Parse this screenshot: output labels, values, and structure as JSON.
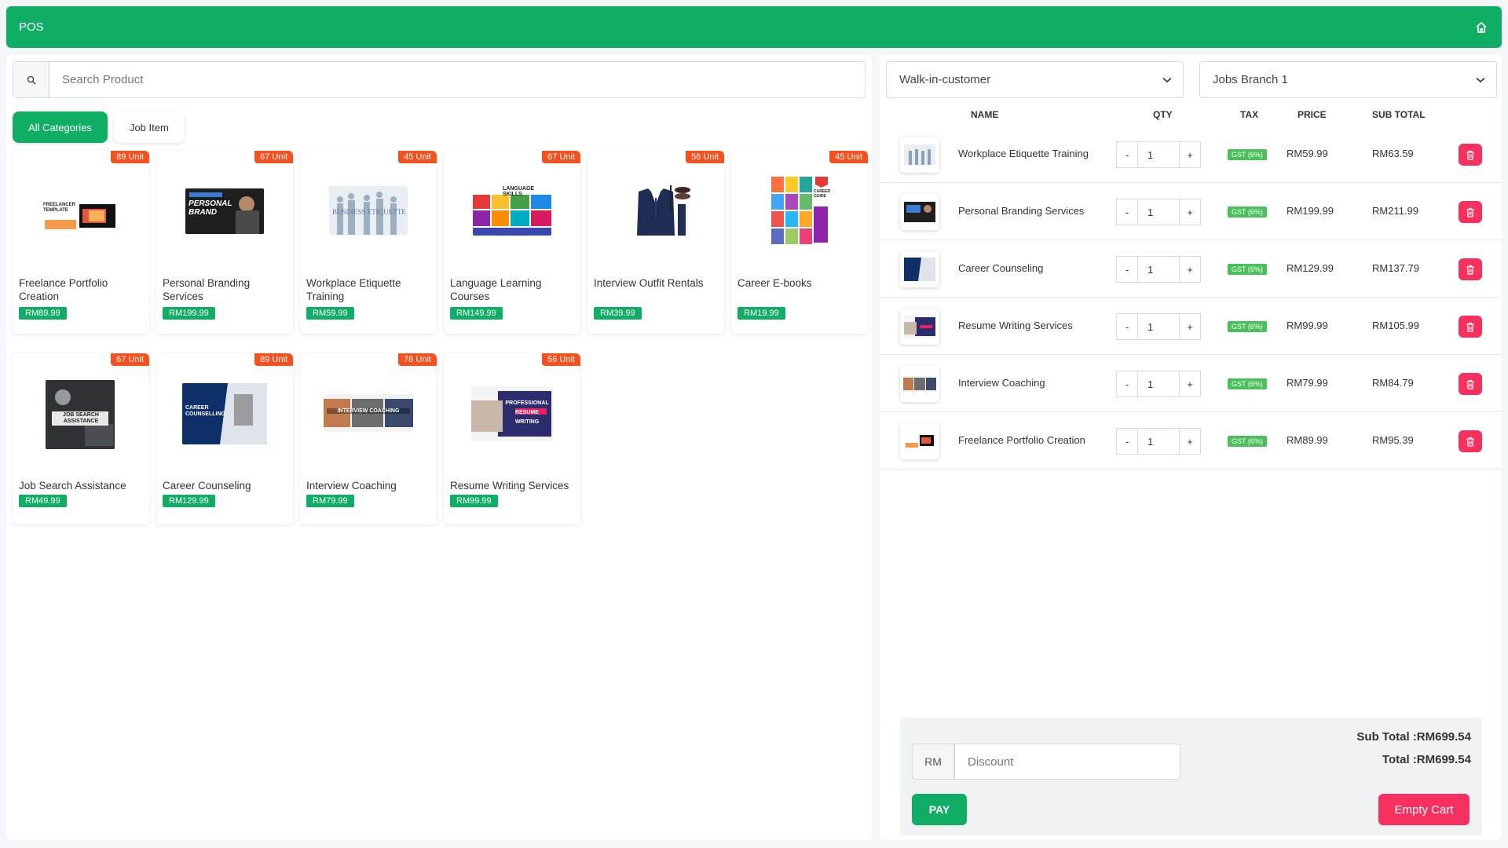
{
  "header": {
    "title": "POS"
  },
  "search": {
    "placeholder": "Search Product"
  },
  "categories": [
    {
      "label": "All Categories",
      "active": true
    },
    {
      "label": "Job Item",
      "active": false
    }
  ],
  "products": [
    {
      "name": "Freelance Portfolio Creation",
      "price": "RM89.99",
      "stock": "89 Unit"
    },
    {
      "name": "Personal Branding Services",
      "price": "RM199.99",
      "stock": "67 Unit"
    },
    {
      "name": "Workplace Etiquette Training",
      "price": "RM59.99",
      "stock": "45 Unit"
    },
    {
      "name": "Language Learning Courses",
      "price": "RM149.99",
      "stock": "67 Unit"
    },
    {
      "name": "Interview Outfit Rentals",
      "price": "RM39.99",
      "stock": "56 Unit"
    },
    {
      "name": "Career E-books",
      "price": "RM19.99",
      "stock": "45 Unit"
    },
    {
      "name": "Job Search Assistance",
      "price": "RM49.99",
      "stock": "67 Unit"
    },
    {
      "name": "Career Counseling",
      "price": "RM129.99",
      "stock": "89 Unit"
    },
    {
      "name": "Interview Coaching",
      "price": "RM79.99",
      "stock": "78 Unit"
    },
    {
      "name": "Resume Writing Services",
      "price": "RM99.99",
      "stock": "56 Unit"
    }
  ],
  "thumb_text": {
    "p0": "FREELANCER TEMPLATE",
    "p1": "PERSONAL BRAND",
    "p2": "BUSINESS ETIQUETTE",
    "p3": "LANGUAGE SKILLS",
    "p5": "CAREER GUIDE",
    "p6": "JOB SEARCH ASSISTANCE",
    "p7": "CAREER COUNSELLING",
    "p8": "INTERVIEW COACHING",
    "p9": "PROFESSIONAL RESUME WRITING"
  },
  "cart": {
    "customer": "Walk-in-customer",
    "branch": "Jobs Branch 1",
    "headers": {
      "name": "NAME",
      "qty": "QTY",
      "tax": "TAX",
      "price": "PRICE",
      "subtotal": "SUB TOTAL"
    },
    "items": [
      {
        "name": "Workplace Etiquette Training",
        "qty": "1",
        "tax": "GST (6%)",
        "price": "RM59.99",
        "subtotal": "RM63.59"
      },
      {
        "name": "Personal Branding Services",
        "qty": "1",
        "tax": "GST (6%)",
        "price": "RM199.99",
        "subtotal": "RM211.99"
      },
      {
        "name": "Career Counseling",
        "qty": "1",
        "tax": "GST (6%)",
        "price": "RM129.99",
        "subtotal": "RM137.79"
      },
      {
        "name": "Resume Writing Services",
        "qty": "1",
        "tax": "GST (6%)",
        "price": "RM99.99",
        "subtotal": "RM105.99"
      },
      {
        "name": "Interview Coaching",
        "qty": "1",
        "tax": "GST (6%)",
        "price": "RM79.99",
        "subtotal": "RM84.79"
      },
      {
        "name": "Freelance Portfolio Creation",
        "qty": "1",
        "tax": "GST (6%)",
        "price": "RM89.99",
        "subtotal": "RM95.39"
      }
    ],
    "minus": "-",
    "plus": "+"
  },
  "footer": {
    "currency": "RM",
    "discount_placeholder": "Discount",
    "subtotal": "Sub Total :RM699.54",
    "total": "Total :RM699.54",
    "pay": "PAY",
    "empty": "Empty Cart"
  },
  "colors": {
    "primary": "#10ae64",
    "badge": "#f4511e",
    "danger": "#f6305f",
    "tax": "#49c05a"
  },
  "icons": {
    "home": "home-icon",
    "search": "search-icon",
    "chevron": "chevron-down-icon",
    "trash": "trash-icon"
  }
}
